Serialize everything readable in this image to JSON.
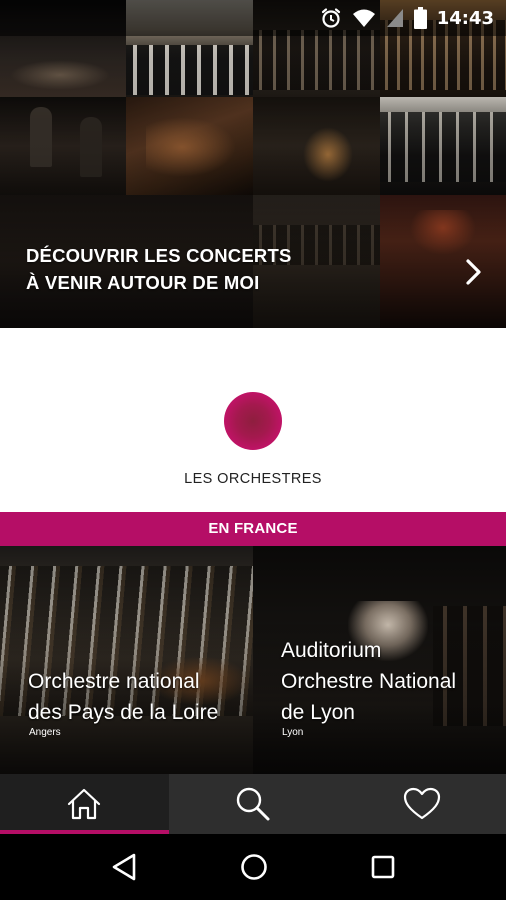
{
  "status_bar": {
    "time": "14:43",
    "icons": [
      "alarm-icon",
      "wifi-icon",
      "signal-icon",
      "battery-icon"
    ]
  },
  "hero": {
    "title_line1": "DÉCOUVRIR LES CONCERTS",
    "title_line2": "À VENIR AUTOUR DE MOI",
    "action_icon": "chevron-right-icon"
  },
  "orchestras": {
    "title": "LES ORCHESTRES",
    "logo": "orchestres-logo",
    "accent_color": "#b50e66"
  },
  "region": {
    "label": "EN FRANCE"
  },
  "cards": [
    {
      "title_line1": "Orchestre national",
      "title_line2": "des Pays de la Loire",
      "city": "Angers"
    },
    {
      "title_line1": "Auditorium",
      "title_line2": "Orchestre National",
      "title_line3": "de Lyon",
      "city": "Lyon"
    }
  ],
  "tabs": [
    {
      "icon": "home-icon",
      "active": true
    },
    {
      "icon": "search-icon",
      "active": false
    },
    {
      "icon": "heart-icon",
      "active": false
    }
  ],
  "navigation": {
    "icons": [
      "back-icon",
      "home-circle-icon",
      "recents-icon"
    ]
  }
}
